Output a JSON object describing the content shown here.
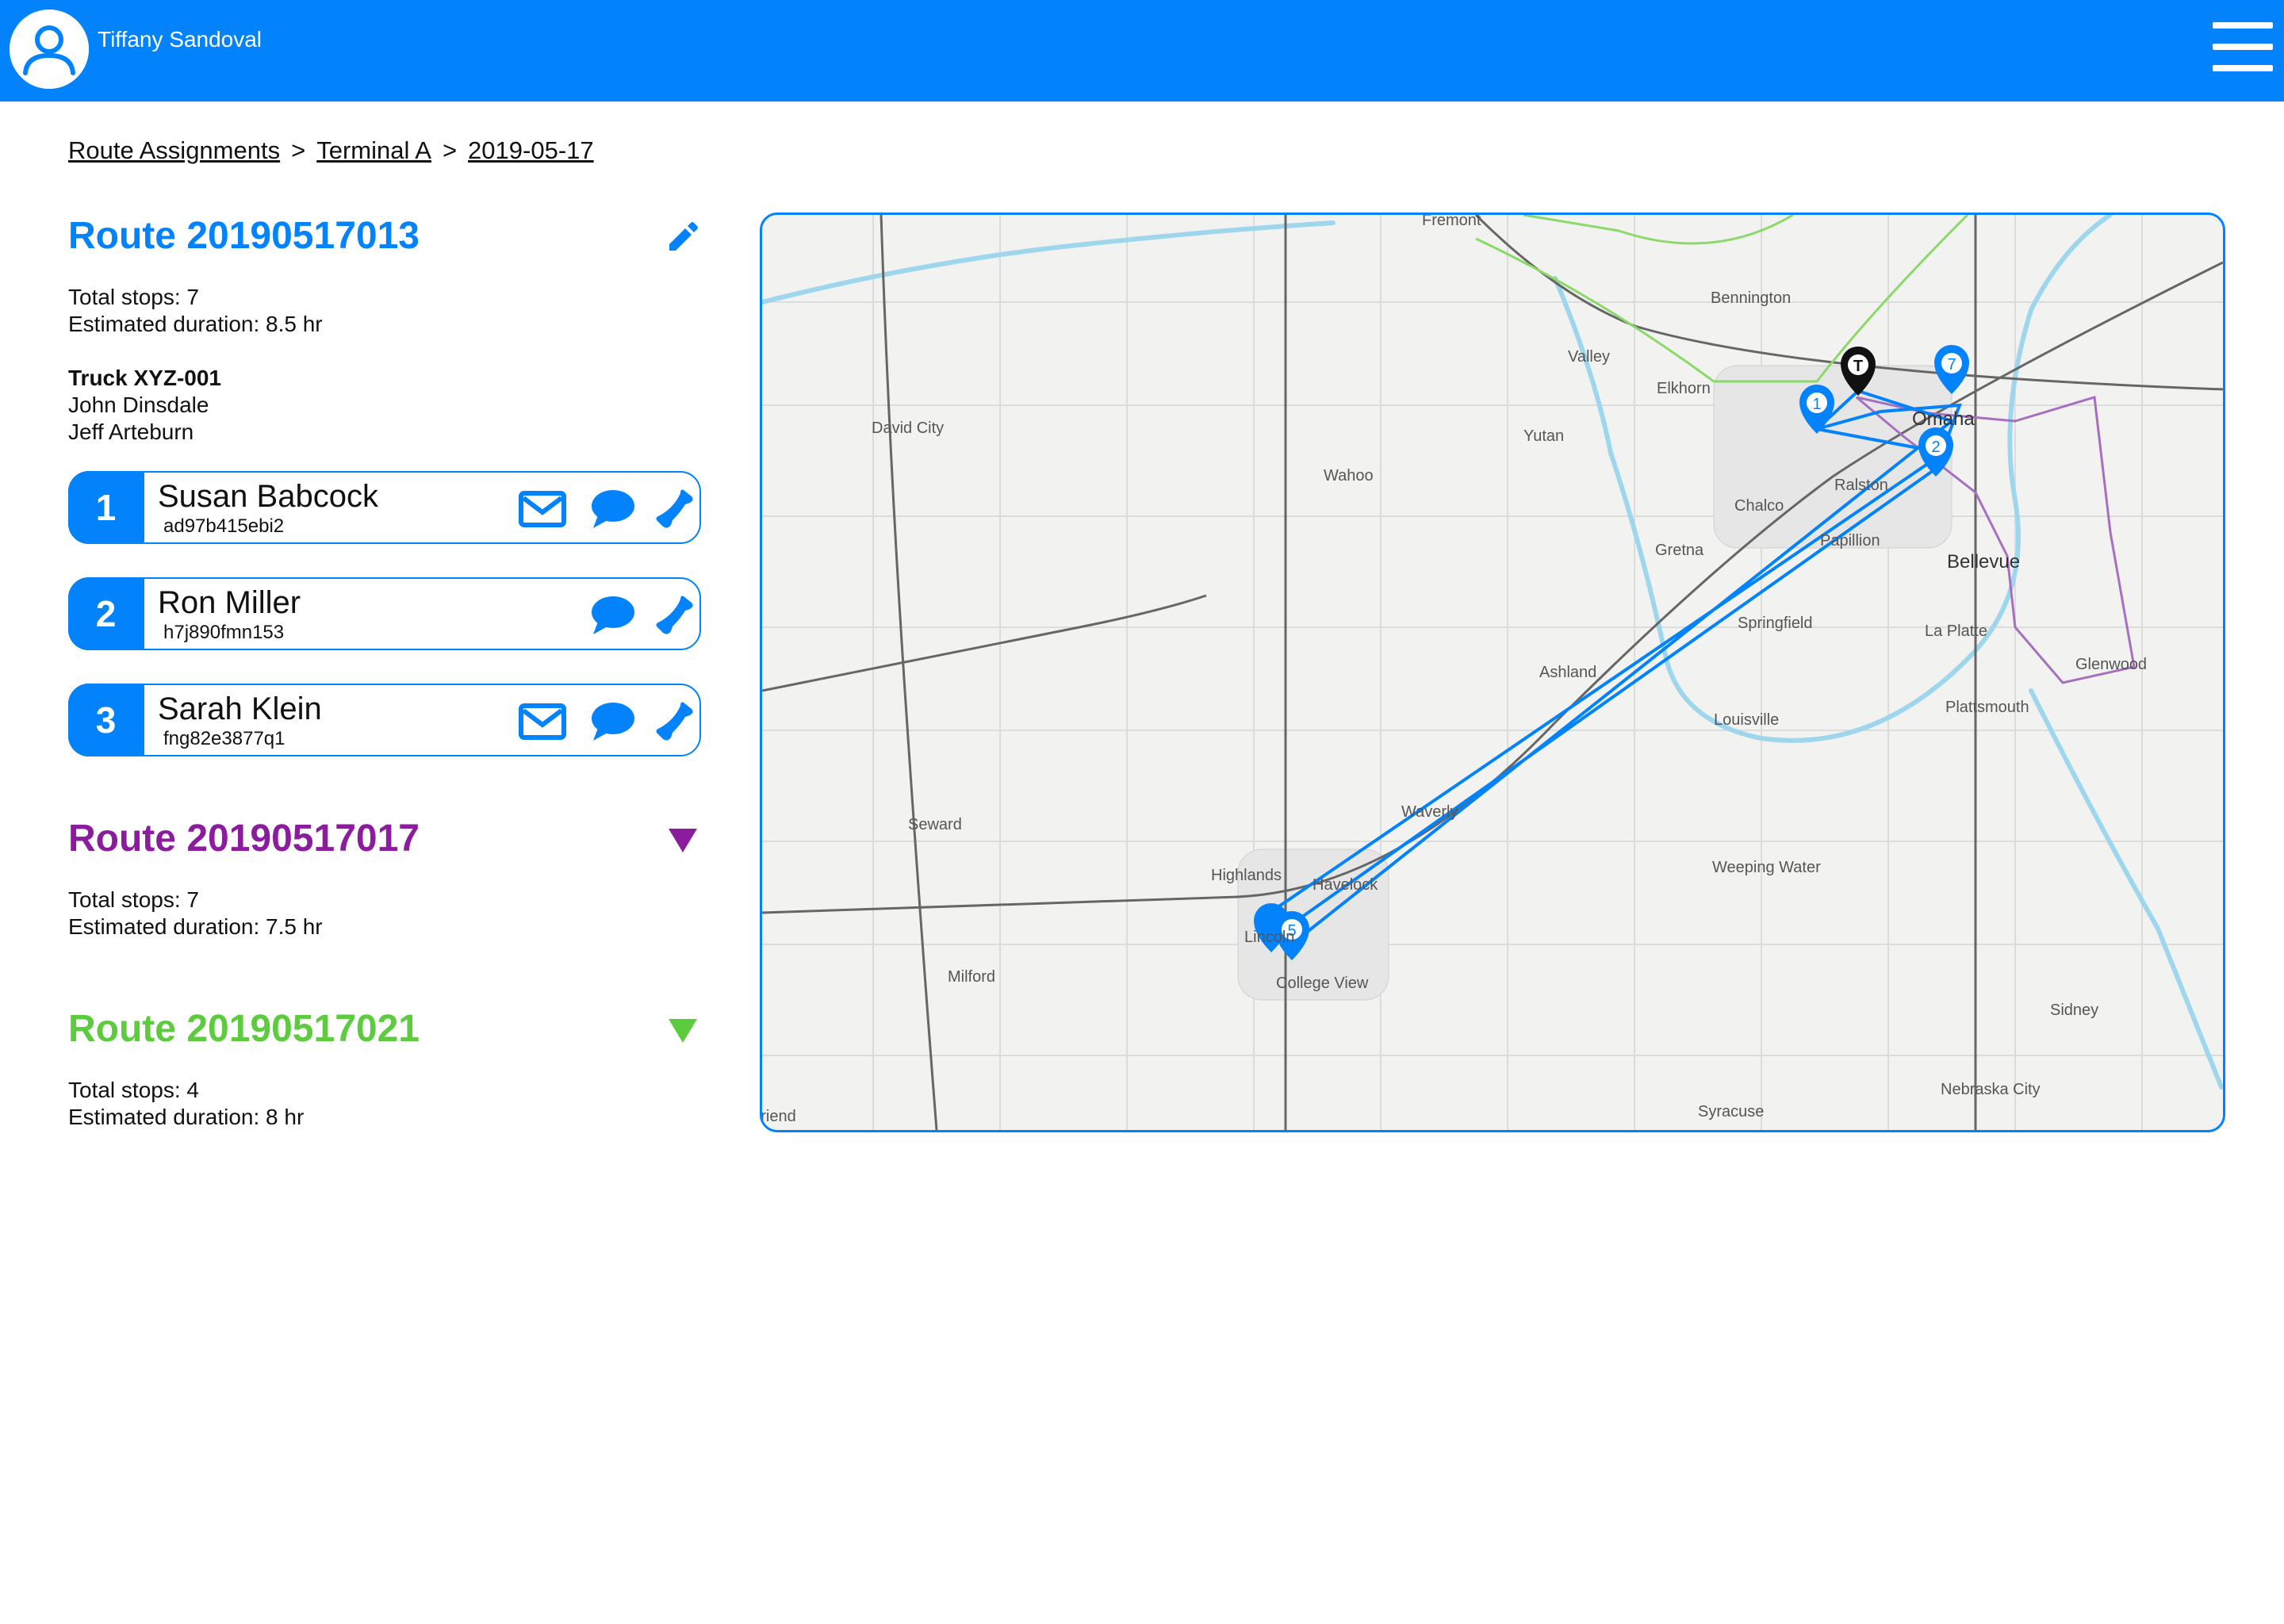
{
  "header": {
    "user_name": "Tiffany Sandoval"
  },
  "breadcrumb": {
    "items": [
      "Route Assignments",
      "Terminal A",
      "2019-05-17"
    ],
    "separator": ">"
  },
  "routes": [
    {
      "title": "Route 20190517013",
      "color": "#0283fb",
      "total_stops": "Total stops: 7",
      "duration": "Estimated duration: 8.5 hr",
      "truck": "Truck XYZ-001",
      "drivers": [
        "John Dinsdale",
        "Jeff Arteburn"
      ],
      "stops": [
        {
          "num": "1",
          "name": "Susan Babcock",
          "id": "ad97b415ebi2"
        },
        {
          "num": "2",
          "name": "Ron Miller",
          "id": "h7j890fmn153"
        },
        {
          "num": "3",
          "name": "Sarah Klein",
          "id": "fng82e3877q1"
        }
      ]
    },
    {
      "title": "Route 20190517017",
      "color": "#8b1c9d",
      "total_stops": "Total stops: 7",
      "duration": "Estimated duration: 7.5 hr"
    },
    {
      "title": "Route 20190517021",
      "color": "#5ccb3d",
      "total_stops": "Total stops: 4",
      "duration": "Estimated duration: 8 hr"
    }
  ],
  "icons": {
    "user": "user-icon",
    "menu": "menu-icon",
    "edit": "pencil-icon",
    "email": "email-icon",
    "message": "chat-icon",
    "phone": "phone-icon",
    "expand": "triangle-down-icon"
  },
  "map": {
    "places": [
      "Fremont",
      "Bennington",
      "Valley",
      "Elkhorn",
      "David City",
      "Yutan",
      "Wahoo",
      "Omaha",
      "Ralston",
      "Chalco",
      "Gretna",
      "Papillion",
      "Bellevue",
      "Springfield",
      "La Platte",
      "Ashland",
      "Glenwood",
      "Louisville",
      "Plattsmouth",
      "Seward",
      "Waverly",
      "Highlands",
      "Havelock",
      "Weeping Water",
      "Lincoln",
      "College View",
      "Milford",
      "Sidney",
      "Nebraska City",
      "Syracuse",
      "Friend"
    ],
    "markers": [
      "T",
      "1",
      "2",
      "7",
      "5"
    ]
  }
}
